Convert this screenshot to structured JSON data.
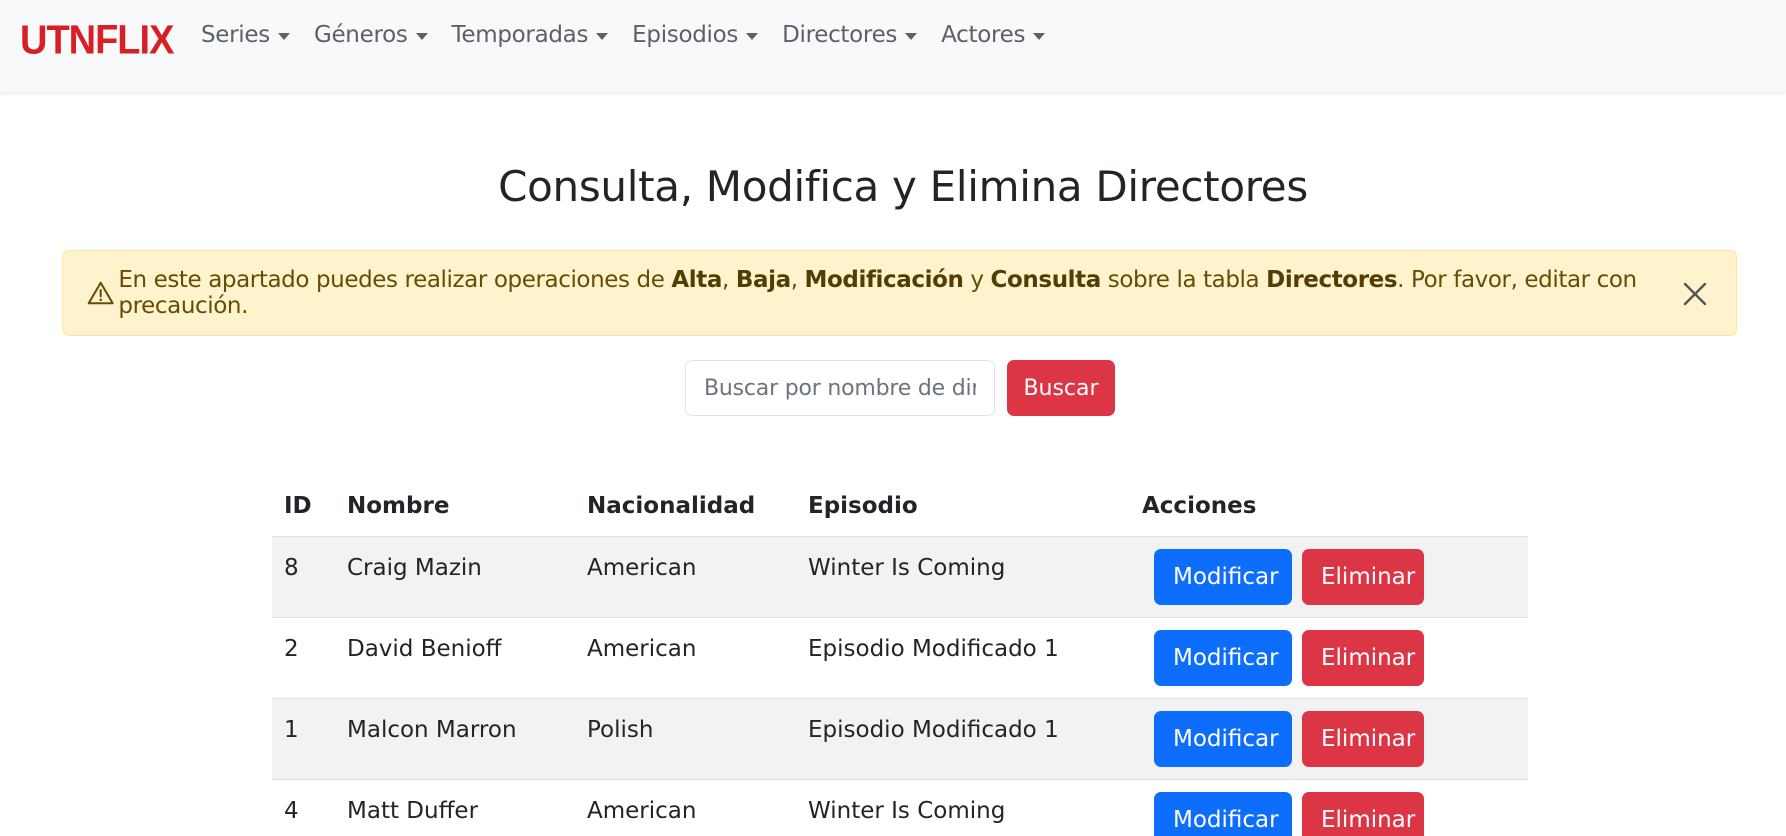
{
  "brand": "UTNFLIX",
  "nav": {
    "items": [
      {
        "label": "Series"
      },
      {
        "label": "Géneros"
      },
      {
        "label": "Temporadas"
      },
      {
        "label": "Episodios"
      },
      {
        "label": "Directores"
      },
      {
        "label": "Actores"
      }
    ]
  },
  "title": "Consulta, Modifica y Elimina Directores",
  "alert": {
    "text_1": "En este apartado puedes realizar operaciones de ",
    "bold_1": "Alta",
    "sep_1": ", ",
    "bold_2": "Baja",
    "sep_2": ", ",
    "bold_3": "Modificación",
    "sep_3": " y ",
    "bold_4": "Consulta",
    "text_2": " sobre la tabla ",
    "bold_5": "Directores",
    "text_3": ". Por favor, editar con precaución.",
    "warning_icon": "warning-triangle-icon",
    "close_icon": "close-icon",
    "bg_color": "#fff3cd"
  },
  "search": {
    "placeholder": "Buscar por nombre de director",
    "button_label": "Buscar"
  },
  "table": {
    "headers": {
      "id": "ID",
      "nombre": "Nombre",
      "nacionalidad": "Nacionalidad",
      "episodio": "Episodio",
      "acciones": "Acciones"
    },
    "rows": [
      {
        "id": "8",
        "nombre": "Craig Mazin",
        "nacionalidad": "American",
        "episodio": "Winter Is Coming",
        "modify": "Modificar",
        "delete": "Eliminar"
      },
      {
        "id": "2",
        "nombre": "David Benioff",
        "nacionalidad": "American",
        "episodio": "Episodio Modificado 1",
        "modify": "Modificar",
        "delete": "Eliminar"
      },
      {
        "id": "1",
        "nombre": "Malcon Marron",
        "nacionalidad": "Polish",
        "episodio": "Episodio Modificado 1",
        "modify": "Modificar",
        "delete": "Eliminar"
      },
      {
        "id": "4",
        "nombre": "Matt Duffer",
        "nacionalidad": "American",
        "episodio": "Winter Is Coming",
        "modify": "Modificar",
        "delete": "Eliminar"
      }
    ]
  },
  "colors": {
    "brand": "#d81f26",
    "primary": "#0d6efd",
    "danger": "#dc3545"
  }
}
